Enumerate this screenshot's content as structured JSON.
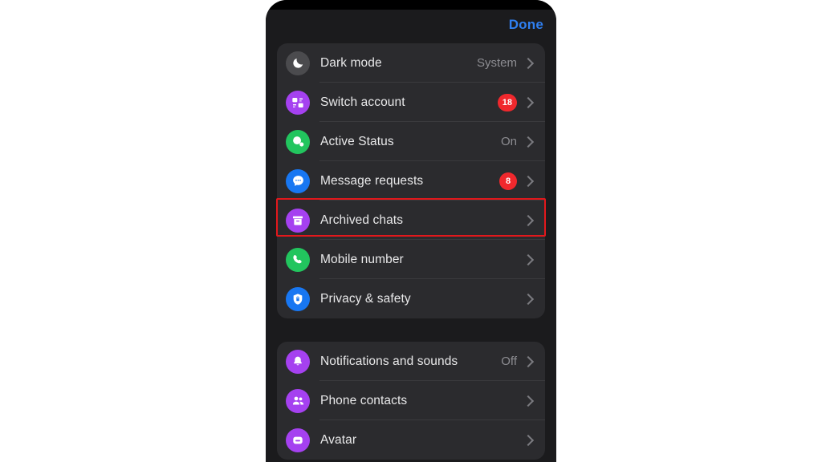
{
  "header": {
    "done_label": "Done"
  },
  "highlight": {
    "target_row": "Archived chats",
    "color": "#e2181c"
  },
  "sections": [
    {
      "rows": [
        {
          "label": "Dark mode",
          "value": "System",
          "badge": "",
          "icon": "moon-icon",
          "icon_bg": "#4b4b4e"
        },
        {
          "label": "Switch account",
          "value": "",
          "badge": "18",
          "icon": "switch-account-icon",
          "icon_bg": "#a541f0"
        },
        {
          "label": "Active Status",
          "value": "On",
          "badge": "",
          "icon": "active-status-icon",
          "icon_bg": "#22c55e"
        },
        {
          "label": "Message requests",
          "value": "",
          "badge": "8",
          "icon": "message-bubble-icon",
          "icon_bg": "#1877f2"
        },
        {
          "label": "Archived chats",
          "value": "",
          "badge": "",
          "icon": "archive-box-icon",
          "icon_bg": "#a541f0"
        },
        {
          "label": "Mobile number",
          "value": "",
          "badge": "",
          "icon": "phone-icon",
          "icon_bg": "#22c55e"
        },
        {
          "label": "Privacy & safety",
          "value": "",
          "badge": "",
          "icon": "lock-shield-icon",
          "icon_bg": "#1877f2"
        }
      ]
    },
    {
      "rows": [
        {
          "label": "Notifications and sounds",
          "value": "Off",
          "badge": "",
          "icon": "bell-icon",
          "icon_bg": "#a541f0"
        },
        {
          "label": "Phone contacts",
          "value": "",
          "badge": "",
          "icon": "people-icon",
          "icon_bg": "#a541f0"
        },
        {
          "label": "Avatar",
          "value": "",
          "badge": "",
          "icon": "avatar-sticker-icon",
          "icon_bg": "#a541f0"
        }
      ]
    }
  ],
  "colors": {
    "accent_blue": "#2f7ff0",
    "badge_red": "#f0282d",
    "card_bg": "#2b2b2e",
    "screen_bg": "#1b1b1d",
    "highlight_red": "#e2181c"
  }
}
